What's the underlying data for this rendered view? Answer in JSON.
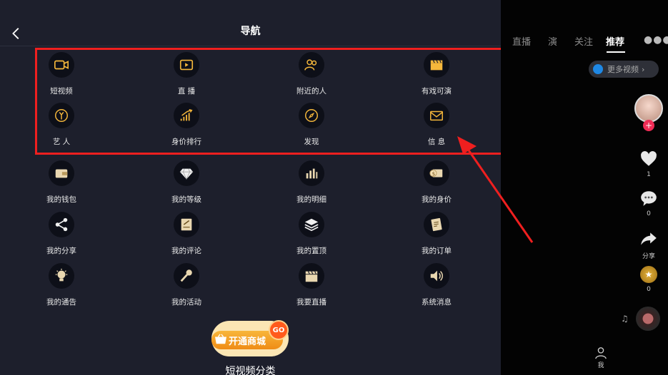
{
  "header": {
    "title": "导航"
  },
  "nav": [
    {
      "label": "短视频",
      "icon": "video-camera-icon"
    },
    {
      "label": "直 播",
      "icon": "live-play-icon"
    },
    {
      "label": "附近的人",
      "icon": "people-icon"
    },
    {
      "label": "有戏可演",
      "icon": "clapperboard-icon"
    },
    {
      "label": "艺 人",
      "icon": "microphone-icon"
    },
    {
      "label": "身价排行",
      "icon": "ranking-chart-icon"
    },
    {
      "label": "发现",
      "icon": "compass-icon"
    },
    {
      "label": "信 息",
      "icon": "envelope-icon"
    }
  ],
  "mine": [
    {
      "label": "我的钱包",
      "icon": "wallet-icon"
    },
    {
      "label": "我的等级",
      "icon": "diamond-icon"
    },
    {
      "label": "我的明细",
      "icon": "bar-chart-icon"
    },
    {
      "label": "我的身价",
      "icon": "money-icon"
    },
    {
      "label": "我的分享",
      "icon": "share-icon"
    },
    {
      "label": "我的评论",
      "icon": "comment-edit-icon"
    },
    {
      "label": "我的置顶",
      "icon": "layers-icon"
    },
    {
      "label": "我的订单",
      "icon": "order-icon"
    },
    {
      "label": "我的通告",
      "icon": "bulb-icon"
    },
    {
      "label": "我的活动",
      "icon": "karaoke-mic-icon"
    },
    {
      "label": "我要直播",
      "icon": "clapper-icon"
    },
    {
      "label": "系统消息",
      "icon": "speaker-icon"
    }
  ],
  "shop": {
    "label": "开通商城",
    "go": "GO"
  },
  "category_label": "短视频分类",
  "right": {
    "tabs": [
      "直播",
      "演",
      "关注",
      "推荐"
    ],
    "active_tab": "推荐",
    "more_videos": "更多视频",
    "like_count": "1",
    "comment_count": "0",
    "share_label": "分享",
    "gift_count": "0",
    "me_label": "我"
  },
  "colors": {
    "panel_bg": "#1d1f2c",
    "accent": "#f5b73b",
    "highlight": "#ef1f1f"
  }
}
